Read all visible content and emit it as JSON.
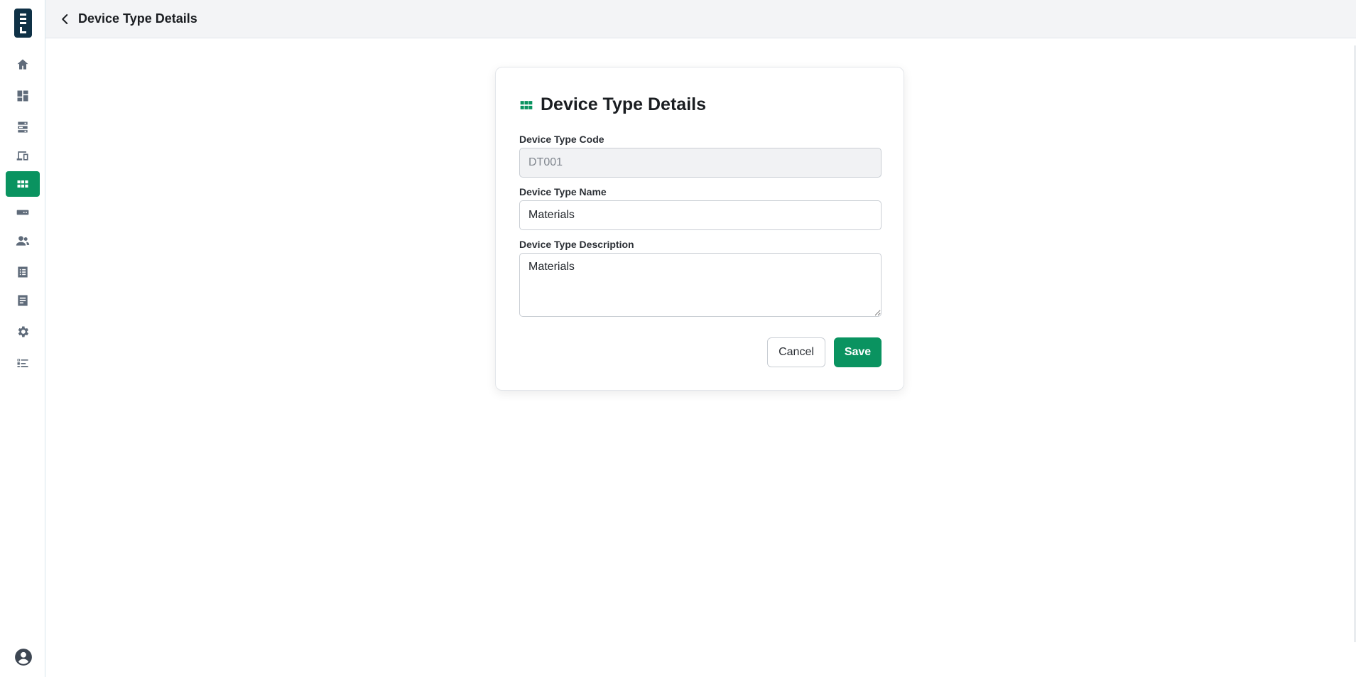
{
  "header": {
    "title": "Device Type Details"
  },
  "sidebar": {
    "items": [
      {
        "icon": "home-icon"
      },
      {
        "icon": "dashboard-icon"
      },
      {
        "icon": "storage-icon"
      },
      {
        "icon": "devices-icon"
      },
      {
        "icon": "device-types-icon",
        "active": true
      },
      {
        "icon": "hardware-icon"
      },
      {
        "icon": "users-icon"
      },
      {
        "icon": "list-icon"
      },
      {
        "icon": "report-icon"
      },
      {
        "icon": "settings-icon"
      },
      {
        "icon": "checklist-icon"
      }
    ],
    "avatar_icon": "account-circle-icon"
  },
  "form": {
    "title": "Device Type Details",
    "code_label": "Device Type Code",
    "code_value": "DT001",
    "name_label": "Device Type Name",
    "name_value": "Materials",
    "description_label": "Device Type Description",
    "description_value": "Materials",
    "cancel_label": "Cancel",
    "save_label": "Save"
  },
  "colors": {
    "accent": "#0a9360",
    "logo_bg": "#0f3146",
    "topbar_bg": "#f3f4f6"
  }
}
